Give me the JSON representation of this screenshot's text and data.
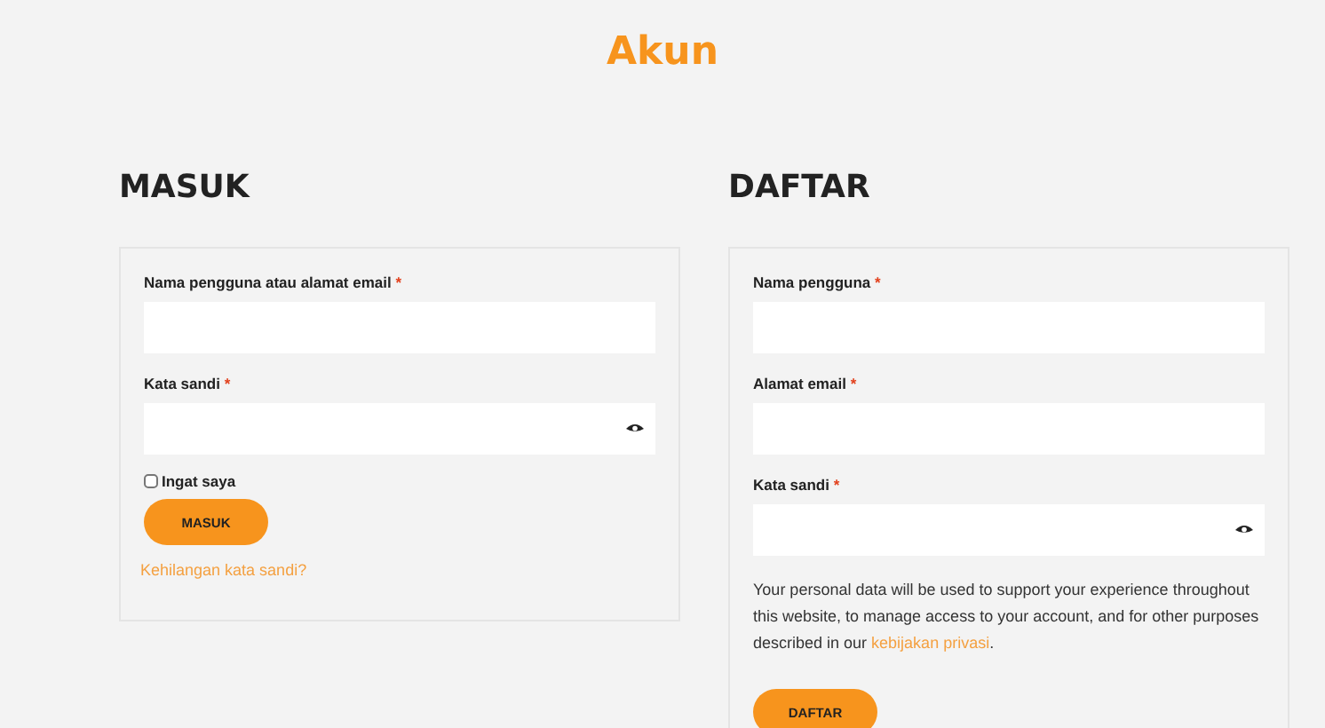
{
  "page_title": "Akun",
  "login": {
    "heading": "MASUK",
    "fields": [
      {
        "label": "Nama pengguna atau alamat email",
        "required_mark": "*",
        "kind": "text"
      },
      {
        "label": "Kata sandi",
        "required_mark": "*",
        "kind": "password"
      }
    ],
    "remember": {
      "label": "Ingat saya",
      "checked": false
    },
    "button": "MASUK",
    "lost_password_link": "Kehilangan kata sandi?"
  },
  "register": {
    "heading": "DAFTAR",
    "fields": [
      {
        "label": "Nama pengguna",
        "required_mark": "*",
        "kind": "text"
      },
      {
        "label": "Alamat email",
        "required_mark": "*",
        "kind": "text"
      },
      {
        "label": "Kata sandi",
        "required_mark": "*",
        "kind": "password"
      }
    ],
    "privacy_text": "Your personal data will be used to support your experience throughout this website, to manage access to your account, and for other purposes described in our ",
    "privacy_link": "kebijakan privasi",
    "privacy_end": ".",
    "button": "DAFTAR"
  }
}
